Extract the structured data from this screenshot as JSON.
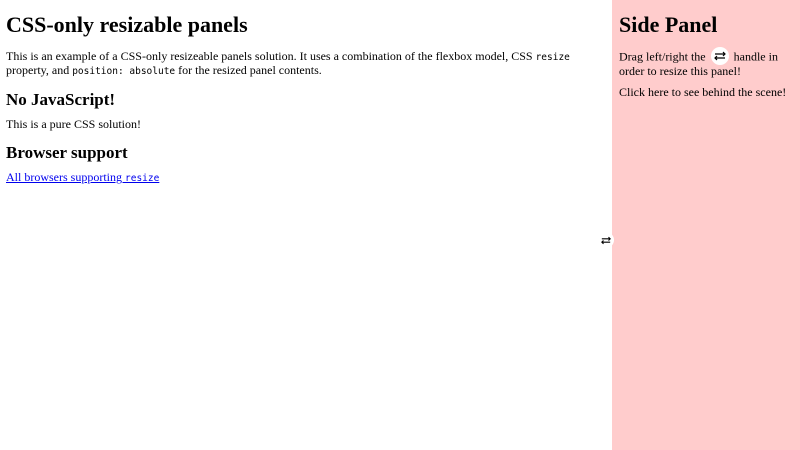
{
  "colors": {
    "side_panel_bg": "#ffcccc",
    "main_bg": "#ffffff",
    "link": "#0000ee"
  },
  "main": {
    "title": "CSS-only resizable panels",
    "intro": {
      "part1": "This is an example of a CSS-only resizeable panels solution. It uses a combination of the flexbox model, CSS ",
      "code1": "resize",
      "part2": " property, and ",
      "code2": "position: absolute",
      "part3": " for the resized panel contents."
    },
    "section1": {
      "heading": "No JavaScript!",
      "text": "This is a pure CSS solution!"
    },
    "section2": {
      "heading": "Browser support",
      "link_text": "All browsers supporting ",
      "link_code": "resize"
    }
  },
  "side": {
    "title": "Side Panel",
    "drag_text_before": "Drag left/right the ",
    "drag_text_after": " handle in order to resize this panel!",
    "behind_text": "Click here to see behind the scene!",
    "handle_icon": "swap-horizontal-arrows"
  },
  "resize_handle": {
    "icon": "swap-horizontal-arrows"
  }
}
